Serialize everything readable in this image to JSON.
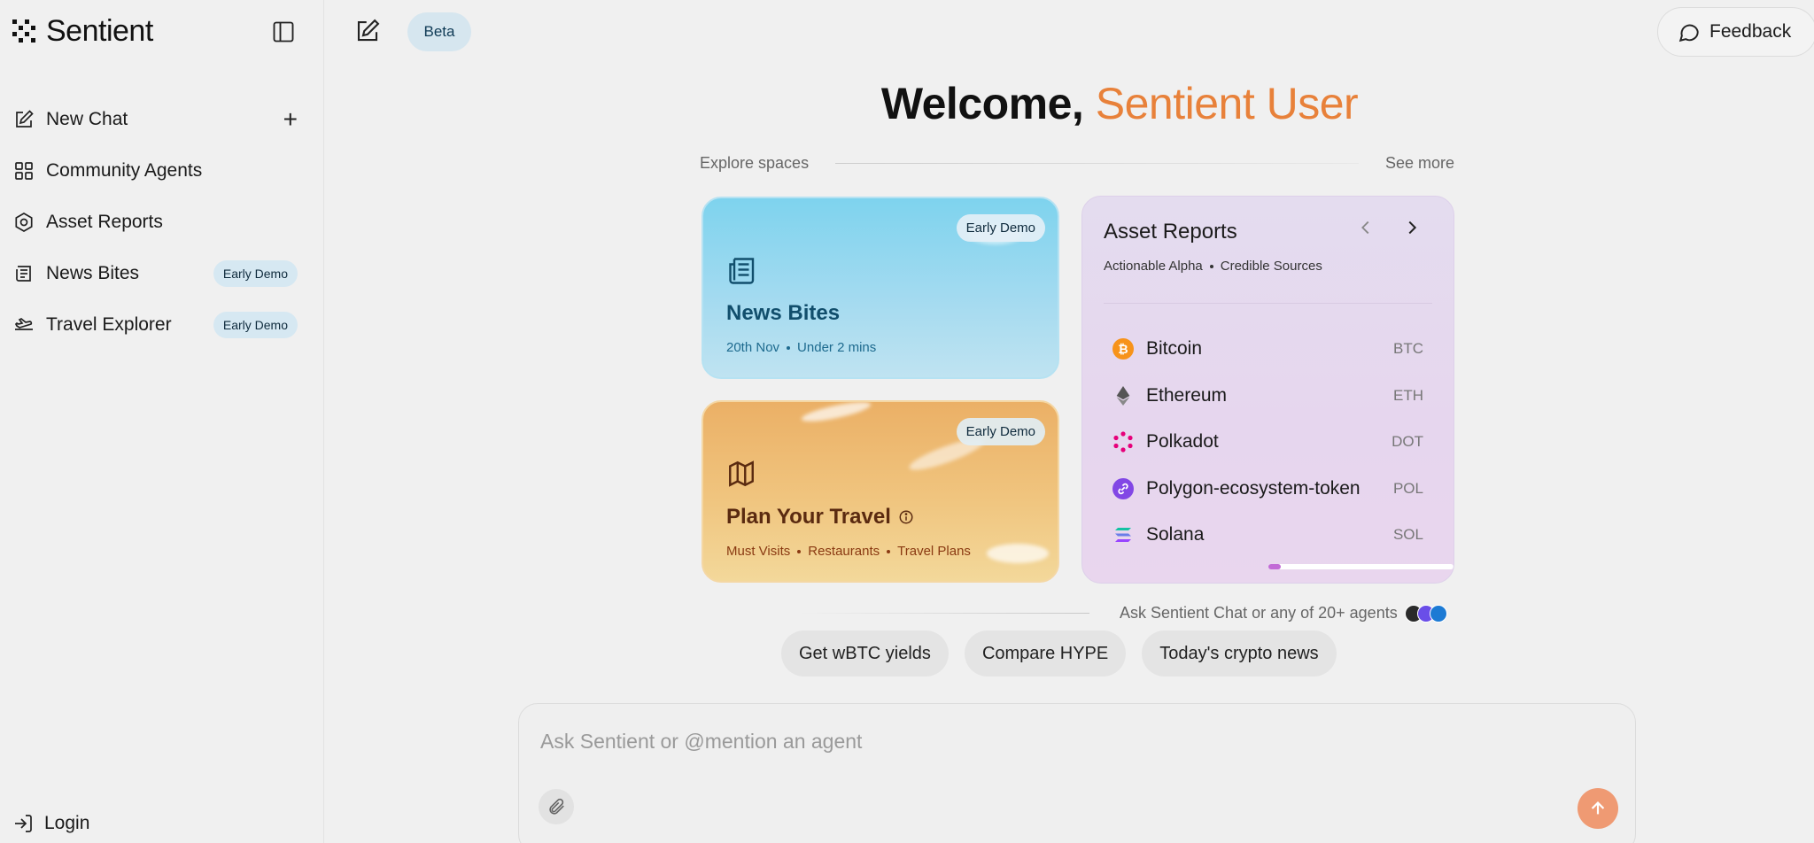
{
  "app": {
    "logo_text": "Sentient",
    "beta_label": "Beta",
    "feedback_label": "Feedback"
  },
  "sidebar": {
    "items": [
      {
        "label": "New Chat",
        "icon": "edit-icon"
      },
      {
        "label": "Community Agents",
        "icon": "grid-icon"
      },
      {
        "label": "Asset Reports",
        "icon": "target-icon"
      },
      {
        "label": "News Bites",
        "icon": "newspaper-icon",
        "badge": "Early Demo"
      },
      {
        "label": "Travel Explorer",
        "icon": "plane-icon",
        "badge": "Early Demo"
      }
    ],
    "login_label": "Login"
  },
  "welcome": {
    "prefix": "Welcome,",
    "name": "Sentient User",
    "name_color": "#e8813a"
  },
  "explore": {
    "label": "Explore spaces",
    "see_more": "See more"
  },
  "cards": {
    "news": {
      "badge": "Early Demo",
      "title": "News Bites",
      "meta": [
        "20th Nov",
        "Under 2 mins"
      ]
    },
    "travel": {
      "badge": "Early Demo",
      "title": "Plan Your Travel",
      "meta": [
        "Must Visits",
        "Restaurants",
        "Travel Plans"
      ]
    }
  },
  "asset_reports": {
    "title": "Asset Reports",
    "subtitle": [
      "Actionable Alpha",
      "Credible Sources"
    ],
    "assets": [
      {
        "name": "Bitcoin",
        "symbol": "BTC",
        "color": "#f7931a"
      },
      {
        "name": "Ethereum",
        "symbol": "ETH",
        "color": "#6b6b8a"
      },
      {
        "name": "Polkadot",
        "symbol": "DOT",
        "color": "#e6007a"
      },
      {
        "name": "Polygon-ecosystem-token",
        "symbol": "POL",
        "color": "#8247e5"
      },
      {
        "name": "Solana",
        "symbol": "SOL",
        "color": "#14c2a3"
      }
    ],
    "scroll_position": 0
  },
  "ask": {
    "text": "Ask Sentient Chat or any of 20+ agents"
  },
  "suggestions": [
    "Get wBTC yields",
    "Compare HYPE",
    "Today's crypto news"
  ],
  "composer": {
    "placeholder": "Ask Sentient or @mention an agent",
    "value": ""
  }
}
